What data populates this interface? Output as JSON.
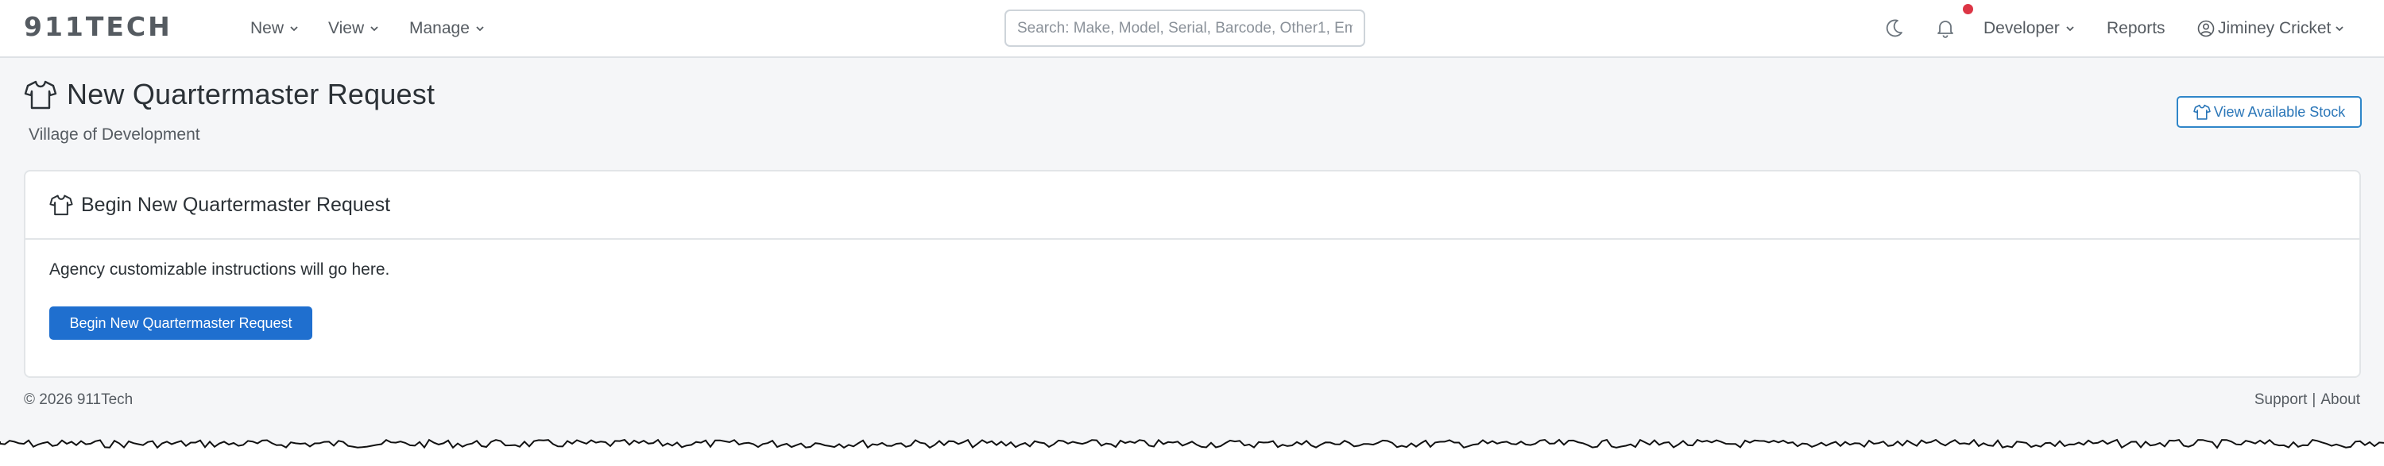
{
  "navbar": {
    "brand": "911TECH",
    "menus": [
      {
        "label": "New"
      },
      {
        "label": "View"
      },
      {
        "label": "Manage"
      }
    ],
    "search": {
      "placeholder": "Search: Make, Model, Serial, Barcode, Other1, Em"
    },
    "developer_label": "Developer",
    "reports_label": "Reports",
    "user_name": "Jiminey Cricket"
  },
  "page": {
    "title": "New Quartermaster Request",
    "subtitle": "Village of Development",
    "view_stock_label": "View Available Stock"
  },
  "card": {
    "header": "Begin New Quartermaster Request",
    "instructions": "Agency customizable instructions will go here.",
    "button_label": "Begin New Quartermaster Request"
  },
  "footer": {
    "copyright": "© 2026 911Tech",
    "support_label": "Support",
    "separator": "|",
    "about_label": "About"
  },
  "colors": {
    "primary": "#1f6fcf",
    "outline_accent": "#2f86c9",
    "notification": "#dc3545",
    "background": "#f5f6f8"
  },
  "icons": [
    "shirt-icon",
    "moon-icon",
    "bell-icon",
    "user-circle-icon",
    "chevron-down-icon"
  ]
}
